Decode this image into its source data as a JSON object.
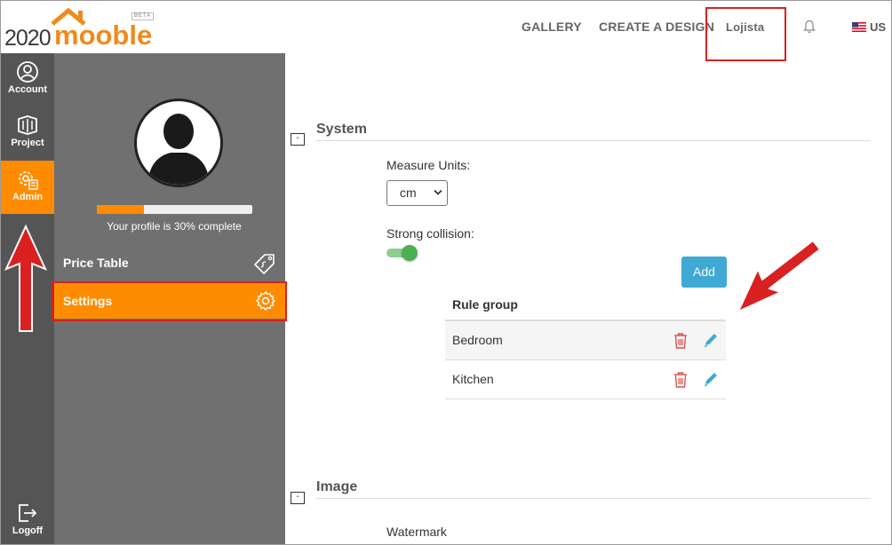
{
  "header": {
    "logo_number": "2020",
    "logo_word": "mooble",
    "logo_badge": "BETA",
    "nav": {
      "gallery": "GALLERY",
      "create": "CREATE A DESIGN",
      "lojista": "Lojista"
    },
    "language": "US"
  },
  "rail": {
    "account": "Account",
    "project": "Project",
    "admin": "Admin",
    "logoff": "Logoff"
  },
  "profile": {
    "progress_fraction": 0.3,
    "progress_text": "Your profile is 30% complete"
  },
  "menu": {
    "price_table": "Price Table",
    "settings": "Settings"
  },
  "system": {
    "toggle": "-",
    "title": "System",
    "measure_units_label": "Measure Units:",
    "measure_units_value": "cm",
    "strong_collision_label": "Strong collision:",
    "strong_collision_on": true,
    "add_label": "Add",
    "rule_group_header": "Rule group",
    "rule_groups": [
      {
        "name": "Bedroom"
      },
      {
        "name": "Kitchen"
      }
    ]
  },
  "image": {
    "toggle": "-",
    "title": "Image",
    "watermark_label": "Watermark"
  },
  "colors": {
    "accent": "#ff8c00",
    "rail_bg": "#555555",
    "panel_bg": "#707070",
    "button_blue": "#3fa9d4",
    "toggle_green": "#4caf50",
    "annotation_red": "#d92121"
  }
}
